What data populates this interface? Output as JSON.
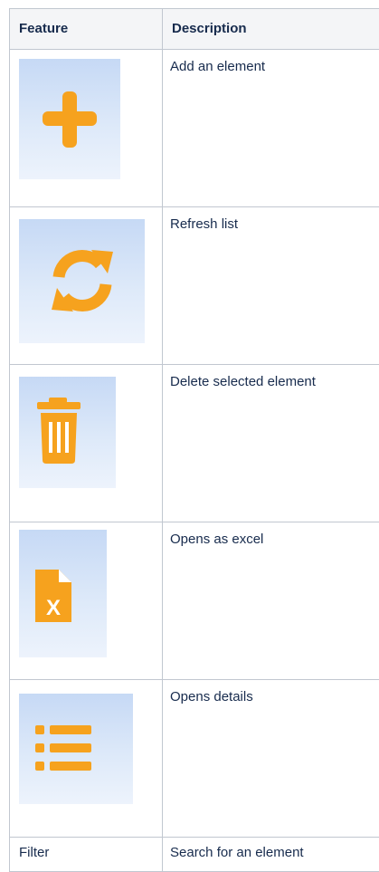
{
  "table": {
    "headers": {
      "feature": "Feature",
      "description": "Description"
    },
    "rows": [
      {
        "feature_icon": "plus-icon",
        "description": "Add an element"
      },
      {
        "feature_icon": "refresh-icon",
        "description": "Refresh list"
      },
      {
        "feature_icon": "trash-icon",
        "description": "Delete selected element"
      },
      {
        "feature_icon": "excel-file-icon",
        "description": "Opens as excel"
      },
      {
        "feature_icon": "list-details-icon",
        "description": "Opens details"
      },
      {
        "feature": "Filter",
        "description": "Search for an element"
      }
    ]
  },
  "colors": {
    "icon_orange": "#f6a21e",
    "thumb_blue_top": "#c6d9f5",
    "thumb_blue_bottom": "#edf3fc",
    "border": "#c1c7d0",
    "header_bg": "#f4f5f7"
  }
}
